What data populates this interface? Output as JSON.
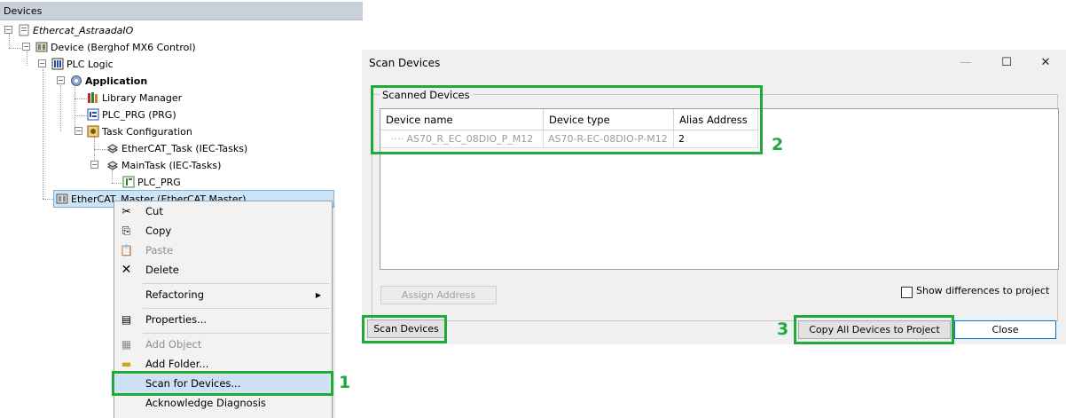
{
  "devices_panel": {
    "title": "Devices",
    "tree": {
      "project": "Ethercat_AstraadaIO",
      "device": "Device (Berghof MX6 Control)",
      "plc_logic": "PLC Logic",
      "application": "Application",
      "library_manager": "Library Manager",
      "plc_prg": "PLC_PRG (PRG)",
      "task_configuration": "Task Configuration",
      "ethercat_task": "EtherCAT_Task (IEC-Tasks)",
      "main_task": "MainTask (IEC-Tasks)",
      "main_task_call": "PLC_PRG",
      "ethercat_master": "EtherCAT_Master (EtherCAT Master)"
    }
  },
  "context_menu": {
    "items": [
      {
        "label": "Cut",
        "icon": "scissors-icon",
        "enabled": true
      },
      {
        "label": "Copy",
        "icon": "copy-icon",
        "enabled": true
      },
      {
        "label": "Paste",
        "icon": "paste-icon",
        "enabled": false
      },
      {
        "label": "Delete",
        "icon": "delete-x-icon",
        "enabled": true
      },
      {
        "label": "Refactoring",
        "icon": "",
        "enabled": true,
        "submenu": true
      },
      {
        "label": "Properties...",
        "icon": "properties-icon",
        "enabled": true
      },
      {
        "label": "Add Object",
        "icon": "add-object-icon",
        "enabled": false
      },
      {
        "label": "Add Folder...",
        "icon": "folder-icon",
        "enabled": true
      },
      {
        "label": "Scan for Devices...",
        "icon": "",
        "enabled": true
      },
      {
        "label": "Acknowledge Diagnosis",
        "icon": "",
        "enabled": true
      }
    ]
  },
  "scan_dialog": {
    "title": "Scan Devices",
    "group_caption": "Scanned Devices",
    "columns": [
      "Device name",
      "Device type",
      "Alias Address"
    ],
    "rows": [
      {
        "device_name": "AS70_R_EC_08DIO_P_M12",
        "device_type": "AS70-R-EC-08DIO-P-M12",
        "alias_address": "2"
      }
    ],
    "assign_address_label": "Assign Address",
    "show_differences_label": "Show differences to project",
    "show_differences_checked": false,
    "scan_devices_label": "Scan Devices",
    "copy_all_label": "Copy All Devices to Project",
    "close_label": "Close"
  },
  "annotations": {
    "step1": "1",
    "step2": "2",
    "step3": "3",
    "color": "#1faa3a"
  },
  "colors": {
    "header_bg": "#c8d0dc",
    "selection_bg": "#cce4f7",
    "menu_highlight": "#cfe0f4",
    "dialog_bg": "#f0f0f0"
  }
}
